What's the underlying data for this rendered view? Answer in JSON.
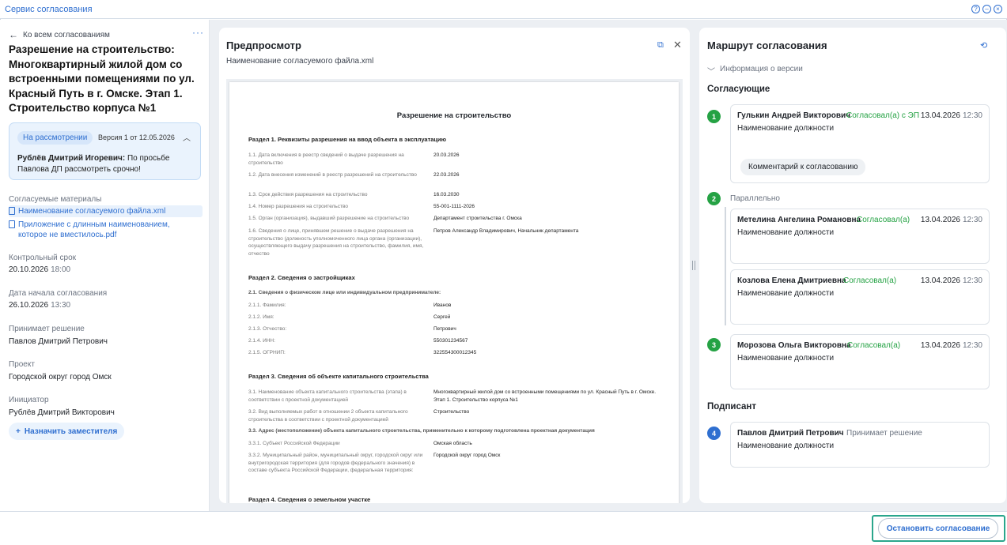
{
  "app": {
    "title": "Сервис согласования",
    "window_controls": [
      "help",
      "minimize",
      "close"
    ]
  },
  "left": {
    "back_label": "Ко всем согласованиям",
    "more_label": "···",
    "title": "Разрешение на строительство: Многоквартирный жилой дом со встроенными помещениями по ул. Красный Путь в г. Омске. Этап 1. Строительство корпуса №1",
    "status_badge": "На рассмотрении",
    "version_label": "Версия 1 от 12.05.2026",
    "note_author": "Рублёв Дмитрий Игоревич:",
    "note_text": " По просьбе Павлова ДП рассмотреть срочно!",
    "materials_label": "Согласуемые материалы",
    "files": [
      "Наименование согласуемого файла.xml",
      "Приложение с длинным наименованием, которое не вместилось.pdf"
    ],
    "deadline_label": "Контрольный срок",
    "deadline_date": "20.10.2026",
    "deadline_time": "18:00",
    "start_label": "Дата начала согласования",
    "start_date": "26.10.2026",
    "start_time": "13:30",
    "decider_label": "Принимает решение",
    "decider_value": "Павлов Дмитрий Петрович",
    "project_label": "Проект",
    "project_value": "Городской округ город Омск",
    "initiator_label": "Инициатор",
    "initiator_value": "Рублёв Дмитрий Викторович",
    "deputy_button": "Назначить заместителя"
  },
  "preview": {
    "title": "Предпросмотр",
    "file_name": "Наименование согласуемого файла.xml",
    "doc": {
      "title": "Разрешение на строительство",
      "s1": "Раздел 1. Реквизиты разрешения на ввод объекта в эксплуатацию",
      "s1_rows": [
        {
          "k": "1.1. Дата включения в реестр сведений о выдаче разрешения на строительство",
          "v": "20.03.2026"
        },
        {
          "k": "1.2. Дата внесения изменений в реестр разрешений на строительство",
          "v": "22.03.2026"
        },
        {
          "k": "1.3. Срок действия разрешения на строительство",
          "v": "16.03.2030"
        },
        {
          "k": "1.4. Номер разрешения на строительство",
          "v": "55-001-1111-2026"
        },
        {
          "k": "1.5. Орган (организация), выдавший разрешение на строительство",
          "v": "Департамент строительства г. Омска"
        },
        {
          "k": "1.6. Сведения о лице, принявшем решение о выдаче разрешения на строительство (должность уполномоченного лица органа (организации), осуществляющего выдачу разрешения на строительство, фамилия, имя, отчество",
          "v": "Петров Александр Владимирович, Начальник департамента"
        }
      ],
      "s2": "Раздел 2. Сведения о застройщиках",
      "s2_sub": "2.1. Сведения о физическом лице или индивидуальном предпринимателе:",
      "s2_rows": [
        {
          "k": "2.1.1. Фамилия:",
          "v": "Иванов"
        },
        {
          "k": "2.1.2. Имя:",
          "v": "Сергей"
        },
        {
          "k": "2.1.3. Отчество:",
          "v": "Петрович"
        },
        {
          "k": "2.1.4. ИНН:",
          "v": "550301234567"
        },
        {
          "k": "2.1.5. ОГРНИП:",
          "v": "322554300012345"
        }
      ],
      "s3": "Раздел 3. Сведения об объекте капитального строительства",
      "s3_rows": [
        {
          "k": "3.1. Наименование объекта капитального строительства (этапа) в соответствии с проектной документацией",
          "v": "Многоквартирный жилой дом со встроенными помещениями по ул. Красный Путь в г. Омске. Этап 1. Строительство корпуса №1"
        },
        {
          "k": "3.2. Вид выполняемых работ в отношении 2 объекта капитального строительства в соответствии с проектной документацией",
          "v": "Строительство"
        }
      ],
      "s3_sub": "3.3. Адрес (местоположение) объекта капитального строительства, применительно к которому подготовлена проектная документация",
      "s3_rows2": [
        {
          "k": "3.3.1. Субъект Российской Федерации",
          "v": "Омская область"
        },
        {
          "k": "3.3.2. Муниципальный район, муниципальный округ, городской округ или внутригородская территория (для городов федерального значения) в составе субъекта Российской Федерации, федеральная территория:",
          "v": "Городской округ город Омск"
        }
      ],
      "s4": "Раздел 4. Сведения о земельном участке"
    }
  },
  "route": {
    "title": "Маршрут согласования",
    "version_info": "Информация о версии",
    "approvers_label": "Согласующие",
    "parallel_label": "Параллельно",
    "signer_label": "Подписант",
    "steps": [
      "1",
      "2",
      "3",
      "4"
    ],
    "cards": [
      {
        "name": "Гулькин Андрей Викторович",
        "status": "Согласовал(а) с ЭП",
        "date": "13.04.2026",
        "time": "12:30",
        "position": "Наименование должности",
        "comment": "Комментарий к согласованию"
      },
      {
        "name": "Метелина Ангелина Романовна",
        "status": "Согласовал(а)",
        "date": "13.04.2026",
        "time": "12:30",
        "position": "Наименование должности"
      },
      {
        "name": "Козлова Елена Дмитриевна",
        "status": "Согласовал(а)",
        "date": "13.04.2026",
        "time": "12:30",
        "position": "Наименование должности"
      },
      {
        "name": "Морозова Ольга Викторовна",
        "status": "Согласовал(а)",
        "date": "13.04.2026",
        "time": "12:30",
        "position": "Наименование должности"
      },
      {
        "name": "Павлов Дмитрий Петрович",
        "status": "Принимает решение",
        "position": "Наименование должности"
      }
    ]
  },
  "footer": {
    "stop_button": "Остановить согласование"
  },
  "colors": {
    "accent": "#2f6fd0",
    "success": "#25a244",
    "focus": "#2aa68c"
  }
}
